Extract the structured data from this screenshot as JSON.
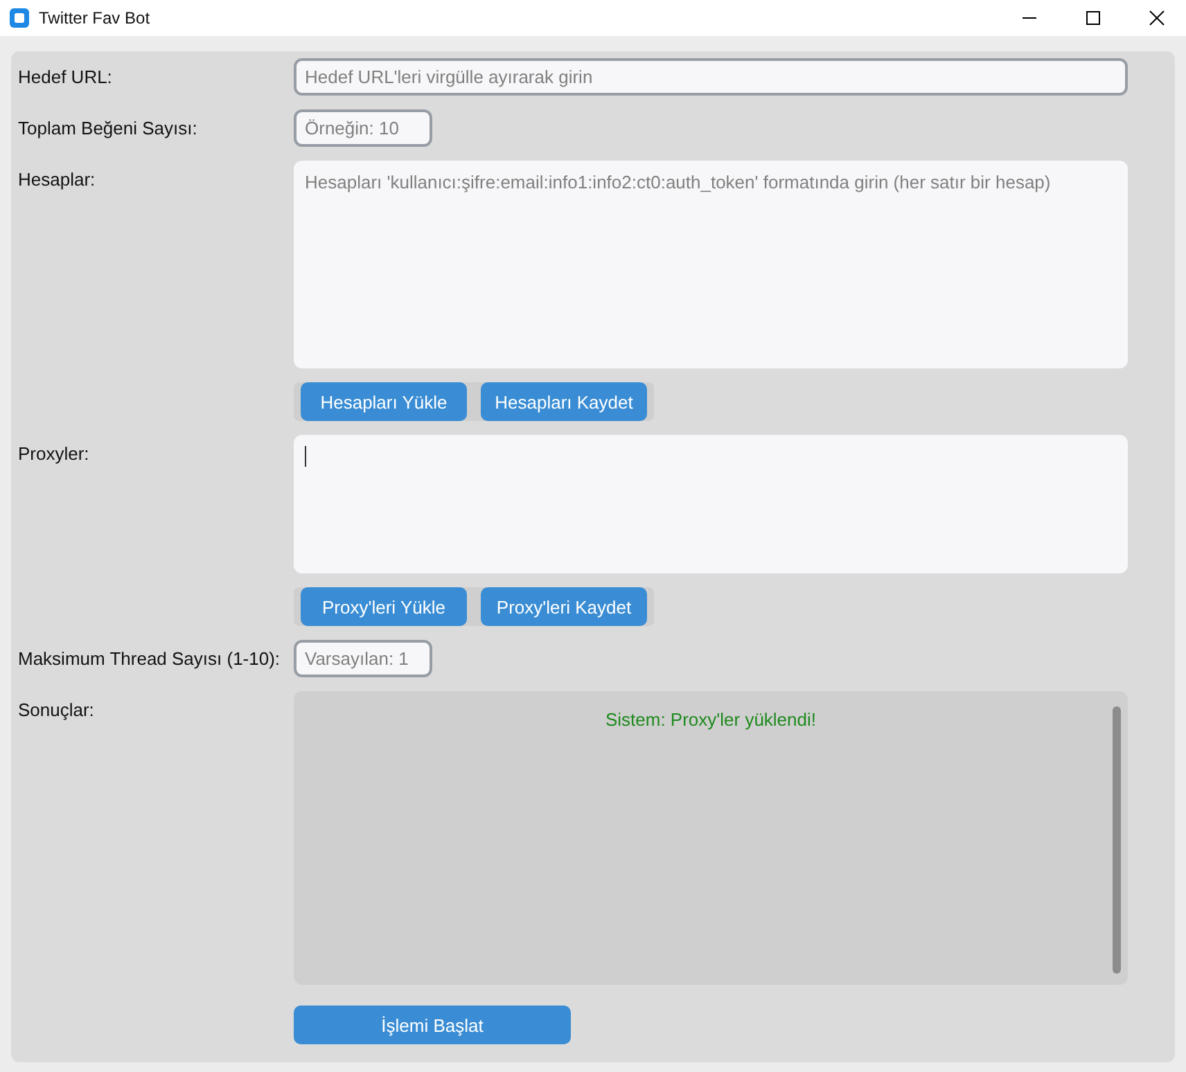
{
  "window": {
    "title": "Twitter Fav Bot"
  },
  "form": [
    {
      "kind": "input",
      "label": "Hedef URL:",
      "placeholder": "Hedef URL'leri virgülle ayırarak girin",
      "wide": true
    },
    {
      "kind": "input",
      "label": "Toplam Beğeni Sayısı:",
      "placeholder": "Örneğin: 10",
      "wide": false
    },
    {
      "kind": "textarea",
      "label": "Hesaplar:",
      "placeholder": "Hesapları 'kullanıcı:şifre:email:info1:info2:ct0:auth_token' formatında girin (her satır bir hesap)",
      "focused": false,
      "tall": true,
      "buttons": [
        "Hesapları Yükle",
        "Hesapları Kaydet"
      ]
    },
    {
      "kind": "textarea",
      "label": "Proxyler:",
      "focused": true,
      "tall": false,
      "buttons": [
        "Proxy'leri Yükle",
        "Proxy'leri Kaydet"
      ]
    },
    {
      "kind": "input",
      "label": "Maksimum Thread Sayısı (1-10):",
      "placeholder": "Varsayılan: 1",
      "wide": false
    },
    {
      "kind": "log",
      "label": "Sonuçlar:",
      "messages": [
        {
          "text": "Sistem: Proxy'ler yüklendi!",
          "color": "#1f8a1f"
        }
      ]
    }
  ],
  "start_button": "İşlemi Başlat"
}
